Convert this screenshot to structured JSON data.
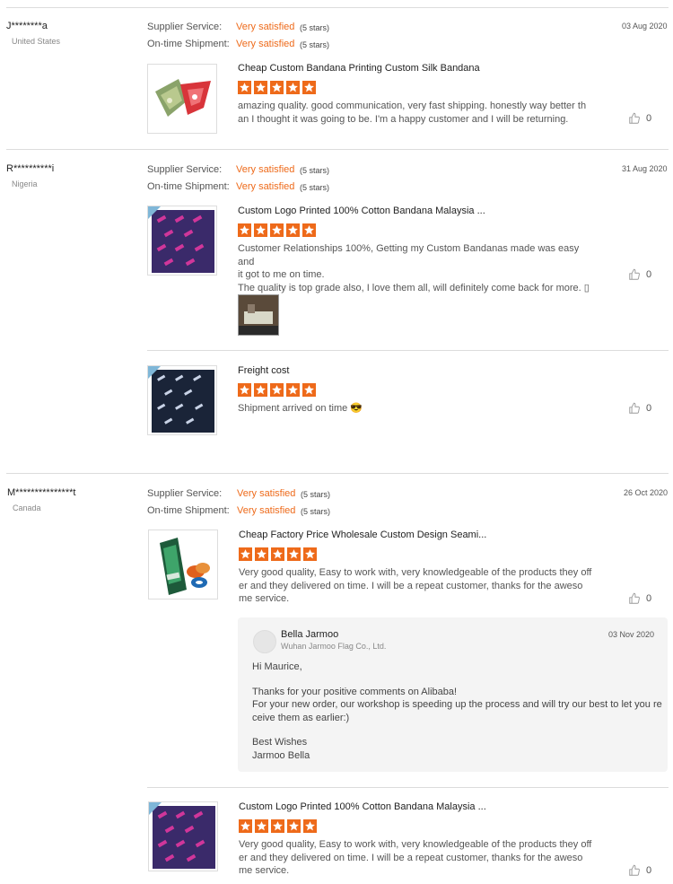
{
  "reviews": [
    {
      "user": "J********a",
      "country": "United States",
      "date": "03 Aug 2020",
      "supplier_label": "Supplier Service:",
      "supplier_value": "Very satisfied",
      "supplier_stars": "(5 stars)",
      "shipment_label": "On-time Shipment:",
      "shipment_value": "Very satisfied",
      "shipment_stars": "(5 stars)",
      "items": [
        {
          "title": "Cheap Custom Bandana Printing Custom Silk Bandana",
          "rating": 5,
          "text_lines": [
            "amazing quality. good communication, very fast shipping.  honestly way better th",
            "an I thought it was going to be. I'm a happy customer and I will be returning."
          ],
          "likes": "0"
        }
      ]
    },
    {
      "user": "R**********i",
      "country": "Nigeria",
      "date": "31 Aug 2020",
      "supplier_label": "Supplier Service:",
      "supplier_value": "Very satisfied",
      "supplier_stars": "(5 stars)",
      "shipment_label": "On-time Shipment:",
      "shipment_value": "Very satisfied",
      "shipment_stars": "(5 stars)",
      "items": [
        {
          "title": "Custom Logo Printed 100% Cotton Bandana Malaysia ...",
          "rating": 5,
          "text_lines": [
            "Customer Relationships 100%, Getting my Custom Bandanas made was easy and",
            "it got to me on time.",
            "The quality is top grade also, I love them all, will definitely come back for more. ▯"
          ],
          "likes": "0"
        },
        {
          "title": "Freight cost",
          "rating": 5,
          "text_lines": [
            "Shipment arrived on time 😎"
          ],
          "likes": "0"
        }
      ]
    },
    {
      "user": "M***************t",
      "country": "Canada",
      "date": "26 Oct 2020",
      "supplier_label": "Supplier Service:",
      "supplier_value": "Very satisfied",
      "supplier_stars": "(5 stars)",
      "shipment_label": "On-time Shipment:",
      "shipment_value": "Very satisfied",
      "shipment_stars": "(5 stars)",
      "items": [
        {
          "title": "Cheap Factory Price Wholesale Custom Design Seami...",
          "rating": 5,
          "text_lines": [
            "Very good quality, Easy to work with, very knowledgeable of the products they off",
            "er and they delivered on time.   I will be a repeat customer,  thanks for the aweso",
            "me service."
          ],
          "likes": "0"
        },
        {
          "title": "Custom Logo Printed 100% Cotton Bandana Malaysia ...",
          "rating": 5,
          "text_lines": [
            "Very good quality, Easy to work with, very knowledgeable of the products they off",
            "er and they delivered on time.   I will be a repeat customer,  thanks for the aweso",
            "me service."
          ],
          "likes": "0"
        }
      ],
      "reply": {
        "name": "Bella Jarmoo",
        "company": "Wuhan Jarmoo Flag Co., Ltd.",
        "date": "03 Nov 2020",
        "lines": [
          "Hi Maurice,",
          "",
          "Thanks for your positive comments on Alibaba!",
          "For your new order, our workshop is speeding up the process and will try our best to let you re",
          "ceive them as earlier:)",
          "",
          "Best Wishes",
          "Jarmoo Bella"
        ]
      }
    }
  ],
  "colors": {
    "accent": "#ee6a1a",
    "divider": "#dcdcdc",
    "reply_bg": "#f4f4f4"
  },
  "icons": {
    "star": "star-icon",
    "like": "thumbs-up-icon"
  }
}
